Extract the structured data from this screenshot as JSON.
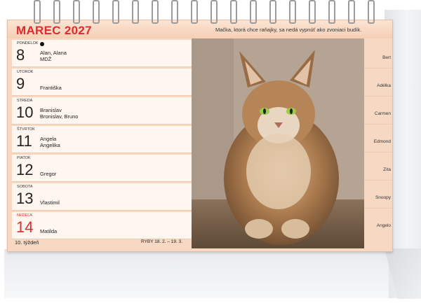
{
  "header": {
    "month": "MAREC 2027",
    "quote": "Mačka, ktorá chce raňajky, sa nedá vypnúť ako zvoniaci budík."
  },
  "days": [
    {
      "day_name": "PONDELOK",
      "number": "8",
      "names": [
        "Alan, Alana",
        "MDŽ"
      ],
      "has_dot": true
    },
    {
      "day_name": "UTOROK",
      "number": "9",
      "names": [
        "Františka"
      ]
    },
    {
      "day_name": "STREDA",
      "number": "10",
      "names": [
        "Branislav",
        "Bronislav, Bruno"
      ]
    },
    {
      "day_name": "ŠTVRTOK",
      "number": "11",
      "names": [
        "Angela",
        "Angelika"
      ]
    },
    {
      "day_name": "PIATOK",
      "number": "12",
      "names": [
        "Gregor"
      ]
    },
    {
      "day_name": "SOBOTA",
      "number": "13",
      "names": [
        "Vlastimil"
      ]
    },
    {
      "day_name": "NEDEĽA",
      "number": "14",
      "names": [
        "Matilda"
      ],
      "sunday": true
    }
  ],
  "right_names": [
    "Bert",
    "Adélka",
    "Carmen",
    "Edmond",
    "Zita",
    "Snoopy",
    "Angelo"
  ],
  "footer": {
    "week": "10. týždeň",
    "zodiac": "RYBY  18. 2. – 19. 3."
  },
  "colors": {
    "accent_red": "#e32a2a",
    "sheet_peach": "#f7d9c3",
    "row_bg": "#fff6ef"
  }
}
